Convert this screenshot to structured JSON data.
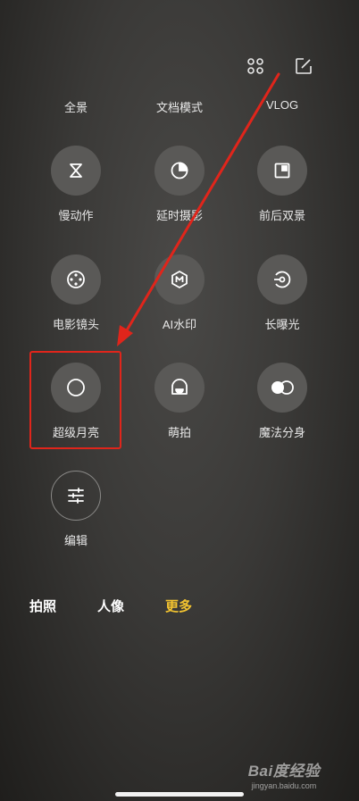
{
  "header": {
    "grid_icon": "grid-icon",
    "edit_icon": "edit-icon"
  },
  "top_labels": [
    "全景",
    "文档模式",
    "VLOG"
  ],
  "modes": [
    {
      "label": "慢动作",
      "icon": "hourglass-icon"
    },
    {
      "label": "延时摄影",
      "icon": "timer-icon"
    },
    {
      "label": "前后双景",
      "icon": "dual-view-icon"
    },
    {
      "label": "电影镜头",
      "icon": "film-reel-icon"
    },
    {
      "label": "AI水印",
      "icon": "watermark-icon"
    },
    {
      "label": "长曝光",
      "icon": "long-exposure-icon"
    },
    {
      "label": "超级月亮",
      "icon": "moon-icon"
    },
    {
      "label": "萌拍",
      "icon": "cute-face-icon"
    },
    {
      "label": "魔法分身",
      "icon": "clone-icon"
    },
    {
      "label": "编辑",
      "icon": "sliders-icon"
    }
  ],
  "bottom_tabs": [
    {
      "label": "拍照",
      "active": false
    },
    {
      "label": "人像",
      "active": false
    },
    {
      "label": "更多",
      "active": true
    }
  ],
  "colors": {
    "accent": "#f4c430",
    "highlight": "#e0251b",
    "icon_bg": "#5a5957"
  },
  "watermark": {
    "logo": "Bai度经验",
    "url": "jingyan.baidu.com"
  }
}
